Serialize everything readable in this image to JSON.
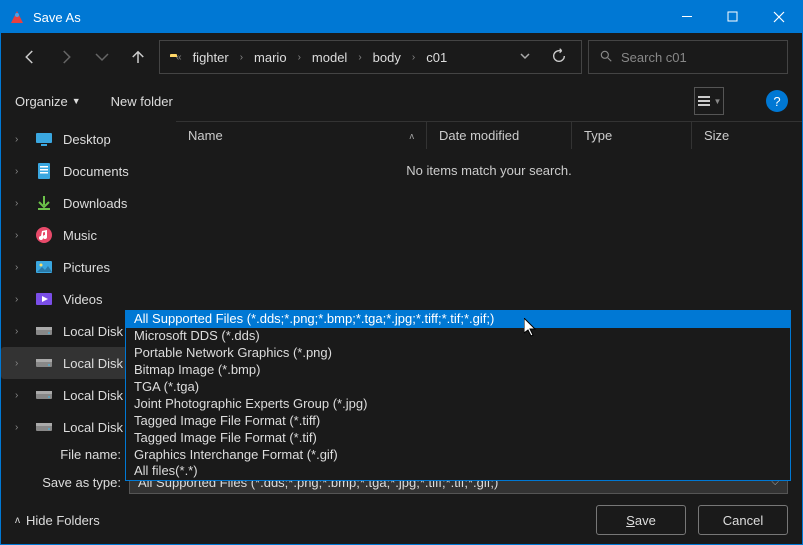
{
  "title": "Save As",
  "breadcrumbs": [
    "fighter",
    "mario",
    "model",
    "body",
    "c01"
  ],
  "search_placeholder": "Search c01",
  "toolbar": {
    "organize": "Organize",
    "newfolder": "New folder"
  },
  "sidebar": [
    {
      "label": "Desktop",
      "icon": "desktop"
    },
    {
      "label": "Documents",
      "icon": "doc"
    },
    {
      "label": "Downloads",
      "icon": "down"
    },
    {
      "label": "Music",
      "icon": "music"
    },
    {
      "label": "Pictures",
      "icon": "pic"
    },
    {
      "label": "Videos",
      "icon": "vid"
    },
    {
      "label": "Local Disk (A",
      "icon": "disk"
    },
    {
      "label": "Local Disk (C",
      "icon": "disk"
    },
    {
      "label": "Local Disk (D",
      "icon": "disk"
    },
    {
      "label": "Local Disk (E",
      "icon": "disk"
    }
  ],
  "columns": {
    "name": "Name",
    "date": "Date modified",
    "type": "Type",
    "size": "Size"
  },
  "empty_text": "No items match your search.",
  "filetype_options": [
    "All Supported Files (*.dds;*.png;*.bmp;*.tga;*.jpg;*.tiff;*.tif;*.gif;)",
    "Microsoft DDS (*.dds)",
    "Portable Network Graphics (*.png)",
    "Bitmap Image (*.bmp)",
    "TGA (*.tga)",
    "Joint Photographic Experts Group (*.jpg)",
    "Tagged Image File Format (*.tiff)",
    "Tagged Image File Format (*.tif)",
    "Graphics Interchange Format (*.gif)",
    "All files(*.*)"
  ],
  "filetype_selected": "All Supported Files (*.dds;*.png;*.bmp;*.tga;*.jpg;*.tiff;*.tif;*.gif;)",
  "fields": {
    "filename_label": "File name:",
    "saveastype_label": "Save as type:"
  },
  "footer": {
    "hide": "Hide Folders",
    "save": "Save",
    "save_ul": "S",
    "cancel": "Cancel"
  }
}
